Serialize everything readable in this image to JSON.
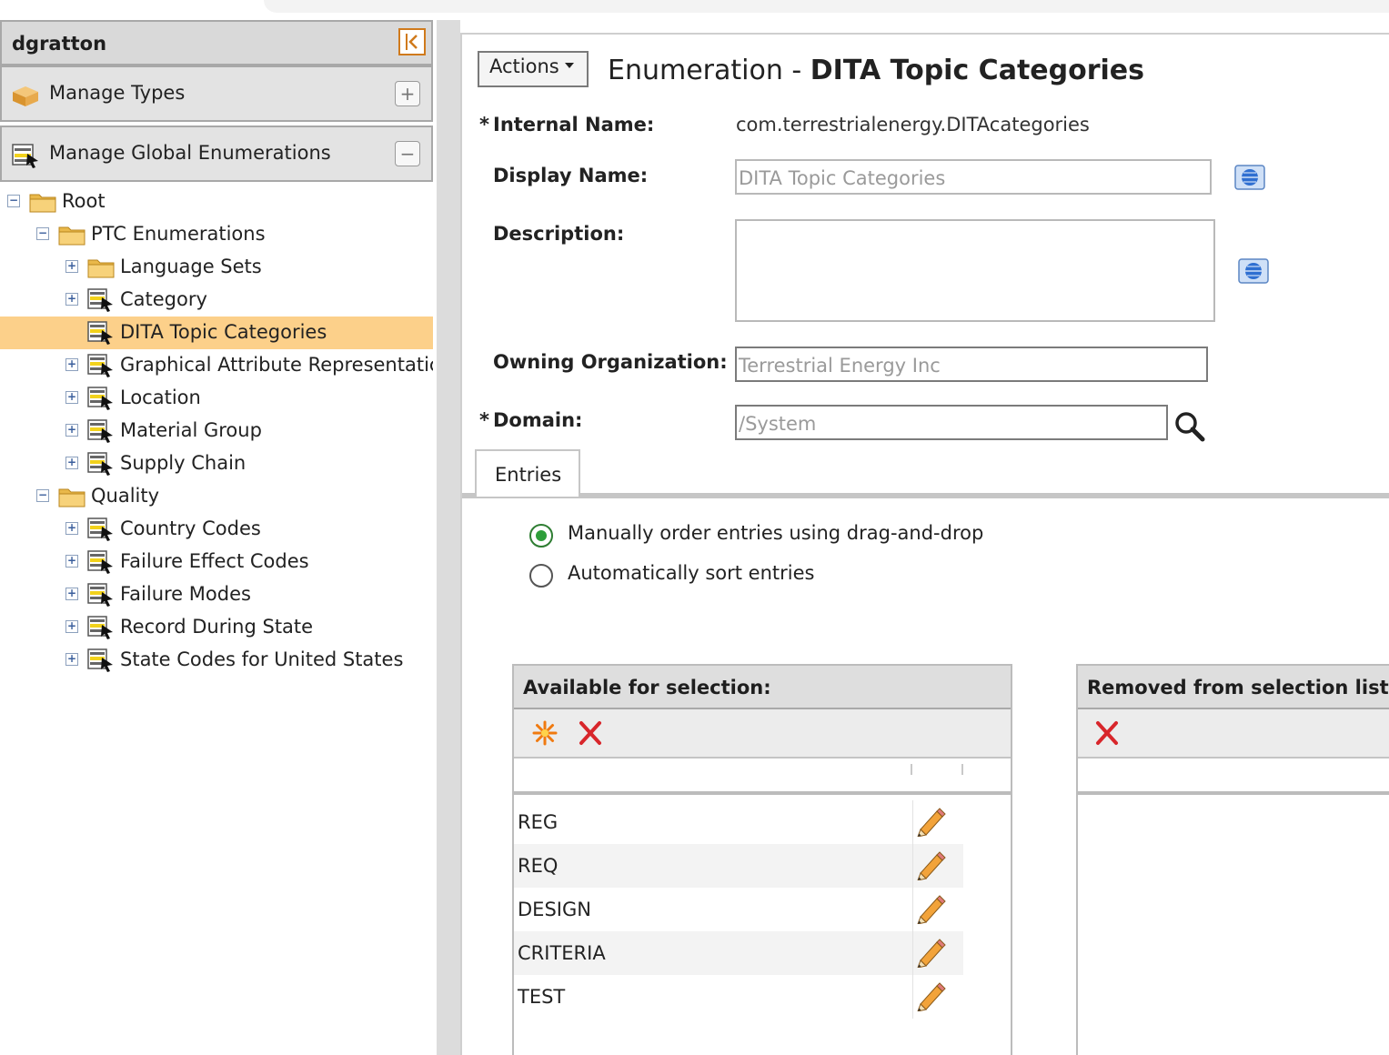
{
  "user": {
    "name": "dgratton"
  },
  "accordion": [
    {
      "label": "Manage Types",
      "toggle": "+",
      "icon": "package-icon"
    },
    {
      "label": "Manage Global Enumerations",
      "toggle": "−",
      "icon": "enumeration-icon"
    }
  ],
  "tree": {
    "nodes": [
      {
        "label": "Root",
        "level": 0,
        "expander": "−",
        "icon": "folder-icon"
      },
      {
        "label": "PTC Enumerations",
        "level": 1,
        "expander": "−",
        "icon": "folder-icon"
      },
      {
        "label": "Language Sets",
        "level": 2,
        "expander": "+",
        "icon": "folder-icon"
      },
      {
        "label": "Category",
        "level": 2,
        "expander": "+",
        "icon": "enumeration-icon"
      },
      {
        "label": "DITA Topic Categories",
        "level": 2,
        "expander": "",
        "icon": "enumeration-icon",
        "selected": true
      },
      {
        "label": "Graphical Attribute Representatic",
        "level": 2,
        "expander": "+",
        "icon": "enumeration-icon"
      },
      {
        "label": "Location",
        "level": 2,
        "expander": "+",
        "icon": "enumeration-icon"
      },
      {
        "label": "Material Group",
        "level": 2,
        "expander": "+",
        "icon": "enumeration-icon"
      },
      {
        "label": "Supply Chain",
        "level": 2,
        "expander": "+",
        "icon": "enumeration-icon"
      },
      {
        "label": "Quality",
        "level": 1,
        "expander": "−",
        "icon": "folder-icon"
      },
      {
        "label": "Country Codes",
        "level": 2,
        "expander": "+",
        "icon": "enumeration-icon"
      },
      {
        "label": "Failure Effect Codes",
        "level": 2,
        "expander": "+",
        "icon": "enumeration-icon"
      },
      {
        "label": "Failure Modes",
        "level": 2,
        "expander": "+",
        "icon": "enumeration-icon"
      },
      {
        "label": "Record During State",
        "level": 2,
        "expander": "+",
        "icon": "enumeration-icon"
      },
      {
        "label": "State Codes for United States",
        "level": 2,
        "expander": "+",
        "icon": "enumeration-icon"
      }
    ]
  },
  "header": {
    "actions_label": "Actions",
    "title_prefix": "Enumeration - ",
    "title_name": "DITA Topic Categories"
  },
  "form": {
    "required_mark": "*",
    "internal_name_label": "Internal Name:",
    "internal_name_value": "com.terrestrialenergy.DITAcategories",
    "display_name_label": "Display Name:",
    "display_name_value": "DITA Topic Categories",
    "description_label": "Description:",
    "description_value": "",
    "owning_org_label": "Owning Organization:",
    "owning_org_value": "Terrestrial Energy Inc",
    "domain_label": "Domain:",
    "domain_value": "/System"
  },
  "tabs": [
    {
      "label": "Entries",
      "active": true
    }
  ],
  "ordering": {
    "manual_label": "Manually order entries using drag-and-drop",
    "auto_label": "Automatically sort entries",
    "selected": "manual"
  },
  "available": {
    "title": "Available for selection:",
    "entries": [
      "REG",
      "REQ",
      "DESIGN",
      "CRITERIA",
      "TEST"
    ]
  },
  "removed": {
    "title": "Removed from selection list:",
    "entries": []
  },
  "colors": {
    "selected_row": "#fcd08a",
    "accent_orange": "#d07a1c",
    "radio_green": "#2e9e3a",
    "delete_red": "#d8262b"
  }
}
